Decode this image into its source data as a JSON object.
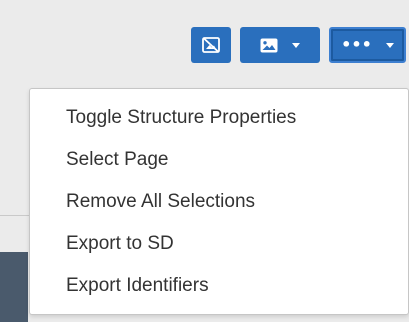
{
  "toolbar": {
    "buttons": [
      {
        "icon": "image-off-icon",
        "color": "#2a6fbd"
      },
      {
        "icon": "image-icon",
        "color": "#2a6fbd",
        "has_caret": true
      },
      {
        "icon": "more-icon",
        "label": "•••",
        "color": "#2a6fbd",
        "has_caret": true,
        "active": true
      }
    ]
  },
  "menu": {
    "items": [
      {
        "label": "Toggle Structure Properties"
      },
      {
        "label": "Select Page"
      },
      {
        "label": "Remove All Selections"
      },
      {
        "label": "Export to SD"
      },
      {
        "label": "Export Identifiers"
      }
    ]
  },
  "colors": {
    "accent": "#2a6fbd",
    "background": "#ebebeb",
    "menu_text": "#333333"
  }
}
